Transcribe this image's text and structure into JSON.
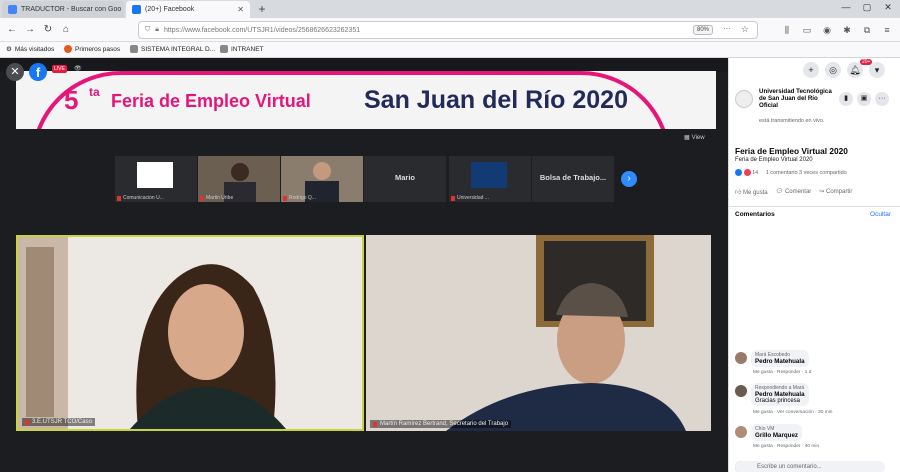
{
  "browser": {
    "tabs": [
      {
        "label": "TRADUCTOR - Buscar con Goo"
      },
      {
        "label": "(20+) Facebook"
      }
    ],
    "url": "https://www.facebook.com/UTSJR1/videos/2568626623262351",
    "zoom": "80%",
    "bookmarks": [
      "Más visitados",
      "Primeros pasos",
      "SISTEMA INTEGRAL D...",
      "INTRANET"
    ]
  },
  "player": {
    "live_badge": "LIVE",
    "banner": {
      "number": "5",
      "superscript": "ta",
      "title": "Feria de Empleo Virtual",
      "right_title": "San Juan del Río 2020"
    },
    "view_label": "View",
    "thumbnails": [
      {
        "name": "",
        "caption": "Comunicacion U..."
      },
      {
        "name": "",
        "caption": "Martin Uribe"
      },
      {
        "name": "",
        "caption": "Rodrigo Q..."
      },
      {
        "name": "Mario",
        "caption": ""
      },
      {
        "name": "",
        "caption": "Universidad ..."
      },
      {
        "name": "Bolsa de Trabajo...",
        "caption": ""
      }
    ],
    "tiles": [
      {
        "caption": "3.E.UTSJR TCO/Caso"
      },
      {
        "caption": "Martín Ramírez Bertrand, Secretario del Trabajo"
      }
    ]
  },
  "sidebar": {
    "notification_count": "20+",
    "page_name": "Universidad Tecnológica de San Juan del Río Oficial",
    "page_status": "está transmitiendo en vivo.",
    "post_title": "Feria de Empleo Virtual 2020",
    "post_subtitle": "Feria de Empleo Virtual 2020",
    "reactions_count": "14",
    "comments_shares": "1 comentario  3 veces compartido",
    "actions": [
      "Me gusta",
      "Comentar",
      "Compartir"
    ],
    "comments_label": "Comentarios",
    "hide_label": "Ocultar",
    "comments": [
      {
        "reply_to": "Mará Escobedo",
        "name": "Pedro Matehuala",
        "text": "",
        "meta": "Me gusta · Responder · 1 d"
      },
      {
        "reply_to": "Respondiendo a Mará",
        "name": "Pedro Matehuala",
        "text": "Gracias princesa",
        "meta": "Me gusta · Ver conversación · 30 min"
      },
      {
        "reply_to": "Chío VM",
        "name": "Grillo Marquez",
        "text": "",
        "meta": "Me gusta · Responder · 40 min"
      }
    ],
    "write_placeholder": "Escribe un comentario..."
  }
}
